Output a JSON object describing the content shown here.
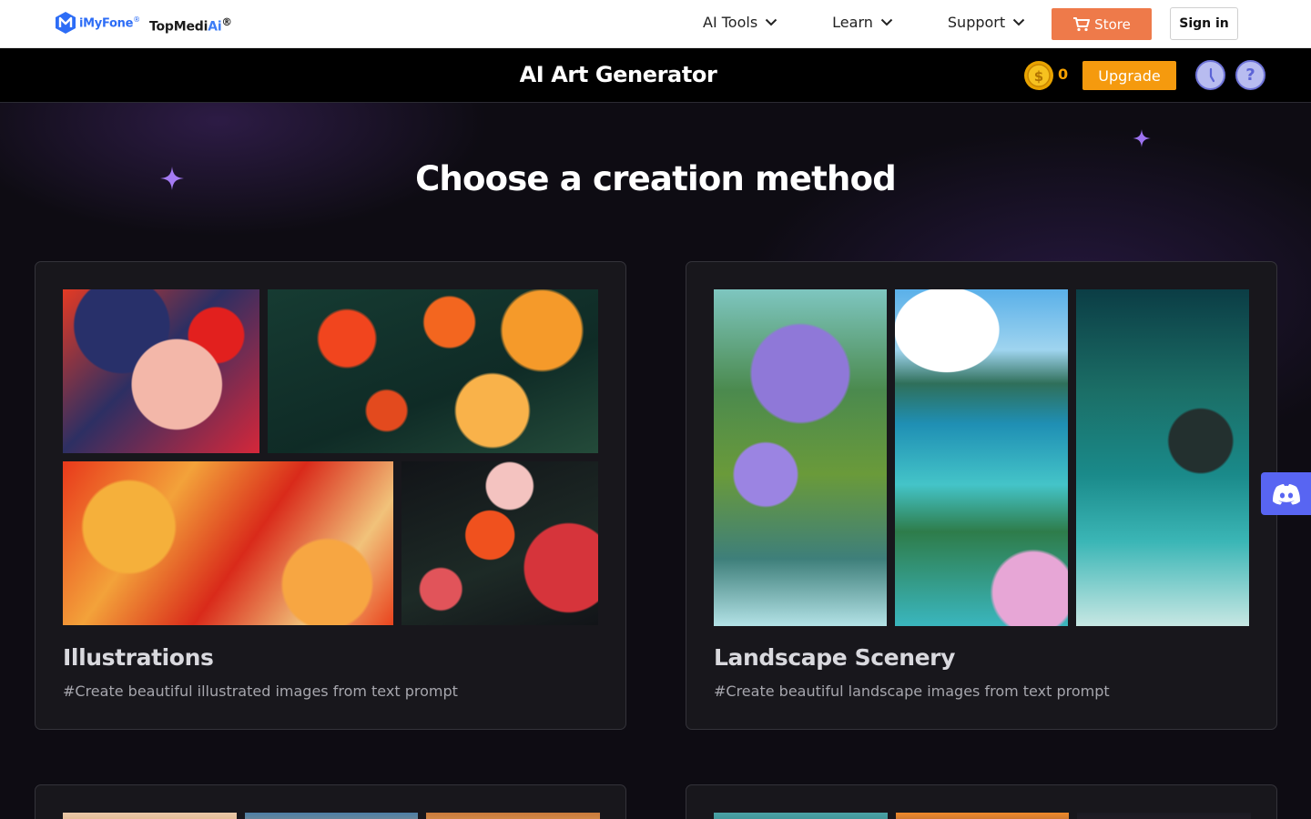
{
  "topnav": {
    "brand": {
      "name": "iMyFone",
      "registered": "®"
    },
    "product": {
      "name_prefix": "TopMedi",
      "name_suffix": "Ai",
      "registered": "®"
    },
    "links": [
      {
        "label": "AI Tools",
        "icon": "chevron-down-icon"
      },
      {
        "label": "Learn",
        "icon": "chevron-down-icon"
      },
      {
        "label": "Support",
        "icon": "chevron-down-icon"
      }
    ],
    "store_label": "Store",
    "signin_label": "Sign in"
  },
  "header": {
    "title": "AI Art Generator",
    "coin_count": "0",
    "upgrade_label": "Upgrade",
    "help_label": "?"
  },
  "main": {
    "title": "Choose a creation method",
    "cards": [
      {
        "name": "Illustrations",
        "description": "#Create beautiful illustrated images from text prompt"
      },
      {
        "name": "Landscape Scenery",
        "description": "#Create beautiful landscape images from text prompt"
      }
    ]
  },
  "colors": {
    "store_button": "#ee7a4a",
    "upgrade_button": "#f59a0e",
    "coin": "#f5a000",
    "discord": "#5865f2",
    "brand_blue": "#2d6df6"
  }
}
